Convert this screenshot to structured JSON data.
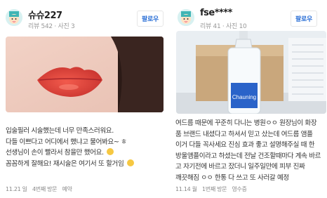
{
  "left_review": {
    "author": "슈슈227",
    "meta": "리뷰 542 · 사진 3",
    "follow_label": "팔로우",
    "lines": [
      "입술필러 시술했는데 너무 만족스러워요.",
      "다들 이쁘다고 어디에서 했냐고 물어봐요~ ㅎ",
      "선생님이 손이 빨라서 참을만 했어요. ",
      "꼼꼼하게 잘해요! 재시술은 여기서 또 할거임 "
    ],
    "footer": {
      "date": "11.21 일",
      "visit": "4번째 방문",
      "method": "예약"
    },
    "avatar_icon": "avatar-icon",
    "photo_icon": "lips-photo"
  },
  "right_review": {
    "author": "fse****",
    "meta": "리뷰 41 · 사진 10",
    "follow_label": "팔로우",
    "lines": [
      "여드름 때문에 꾸준히 다니는 병원ㅇㅇ 원장님이 화장",
      "품 브랜드 내셨다고 하셔서 믿고 샀는데 여드름 앰플",
      "이거 다들 꼭사세요 진심 효과 좋고 설명해주실 때 한",
      "방울앰플이라고 하셨는데 전날 건조할때마다 계속 바르",
      "고 자기전에 바르고 잤더니 일주일만에 피부 진짜",
      "깨끗해짐 ㅇㅇ 한통 다 쓰고 또 사러갈 예정"
    ],
    "footer": {
      "date": "11.14 월",
      "visit": "1번째 방문",
      "method": "영수증"
    },
    "bottle_label": "Chauning",
    "avatar_icon": "avatar-icon",
    "photo_icon": "ampoule-photo"
  },
  "colors": {
    "follow_text": "#2b6fd6",
    "avatar_bg": "#d8f1f1",
    "lip_red": "#e0403a"
  }
}
